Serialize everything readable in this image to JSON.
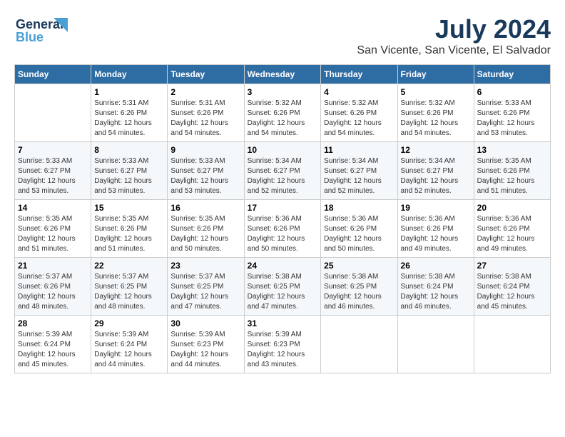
{
  "logo": {
    "line1": "General",
    "line2": "Blue"
  },
  "title": "July 2024",
  "subtitle": "San Vicente, San Vicente, El Salvador",
  "days_of_week": [
    "Sunday",
    "Monday",
    "Tuesday",
    "Wednesday",
    "Thursday",
    "Friday",
    "Saturday"
  ],
  "weeks": [
    [
      {
        "day": "",
        "info": ""
      },
      {
        "day": "1",
        "info": "Sunrise: 5:31 AM\nSunset: 6:26 PM\nDaylight: 12 hours\nand 54 minutes."
      },
      {
        "day": "2",
        "info": "Sunrise: 5:31 AM\nSunset: 6:26 PM\nDaylight: 12 hours\nand 54 minutes."
      },
      {
        "day": "3",
        "info": "Sunrise: 5:32 AM\nSunset: 6:26 PM\nDaylight: 12 hours\nand 54 minutes."
      },
      {
        "day": "4",
        "info": "Sunrise: 5:32 AM\nSunset: 6:26 PM\nDaylight: 12 hours\nand 54 minutes."
      },
      {
        "day": "5",
        "info": "Sunrise: 5:32 AM\nSunset: 6:26 PM\nDaylight: 12 hours\nand 54 minutes."
      },
      {
        "day": "6",
        "info": "Sunrise: 5:33 AM\nSunset: 6:26 PM\nDaylight: 12 hours\nand 53 minutes."
      }
    ],
    [
      {
        "day": "7",
        "info": "Sunrise: 5:33 AM\nSunset: 6:27 PM\nDaylight: 12 hours\nand 53 minutes."
      },
      {
        "day": "8",
        "info": "Sunrise: 5:33 AM\nSunset: 6:27 PM\nDaylight: 12 hours\nand 53 minutes."
      },
      {
        "day": "9",
        "info": "Sunrise: 5:33 AM\nSunset: 6:27 PM\nDaylight: 12 hours\nand 53 minutes."
      },
      {
        "day": "10",
        "info": "Sunrise: 5:34 AM\nSunset: 6:27 PM\nDaylight: 12 hours\nand 52 minutes."
      },
      {
        "day": "11",
        "info": "Sunrise: 5:34 AM\nSunset: 6:27 PM\nDaylight: 12 hours\nand 52 minutes."
      },
      {
        "day": "12",
        "info": "Sunrise: 5:34 AM\nSunset: 6:27 PM\nDaylight: 12 hours\nand 52 minutes."
      },
      {
        "day": "13",
        "info": "Sunrise: 5:35 AM\nSunset: 6:26 PM\nDaylight: 12 hours\nand 51 minutes."
      }
    ],
    [
      {
        "day": "14",
        "info": "Sunrise: 5:35 AM\nSunset: 6:26 PM\nDaylight: 12 hours\nand 51 minutes."
      },
      {
        "day": "15",
        "info": "Sunrise: 5:35 AM\nSunset: 6:26 PM\nDaylight: 12 hours\nand 51 minutes."
      },
      {
        "day": "16",
        "info": "Sunrise: 5:35 AM\nSunset: 6:26 PM\nDaylight: 12 hours\nand 50 minutes."
      },
      {
        "day": "17",
        "info": "Sunrise: 5:36 AM\nSunset: 6:26 PM\nDaylight: 12 hours\nand 50 minutes."
      },
      {
        "day": "18",
        "info": "Sunrise: 5:36 AM\nSunset: 6:26 PM\nDaylight: 12 hours\nand 50 minutes."
      },
      {
        "day": "19",
        "info": "Sunrise: 5:36 AM\nSunset: 6:26 PM\nDaylight: 12 hours\nand 49 minutes."
      },
      {
        "day": "20",
        "info": "Sunrise: 5:36 AM\nSunset: 6:26 PM\nDaylight: 12 hours\nand 49 minutes."
      }
    ],
    [
      {
        "day": "21",
        "info": "Sunrise: 5:37 AM\nSunset: 6:26 PM\nDaylight: 12 hours\nand 48 minutes."
      },
      {
        "day": "22",
        "info": "Sunrise: 5:37 AM\nSunset: 6:25 PM\nDaylight: 12 hours\nand 48 minutes."
      },
      {
        "day": "23",
        "info": "Sunrise: 5:37 AM\nSunset: 6:25 PM\nDaylight: 12 hours\nand 47 minutes."
      },
      {
        "day": "24",
        "info": "Sunrise: 5:38 AM\nSunset: 6:25 PM\nDaylight: 12 hours\nand 47 minutes."
      },
      {
        "day": "25",
        "info": "Sunrise: 5:38 AM\nSunset: 6:25 PM\nDaylight: 12 hours\nand 46 minutes."
      },
      {
        "day": "26",
        "info": "Sunrise: 5:38 AM\nSunset: 6:24 PM\nDaylight: 12 hours\nand 46 minutes."
      },
      {
        "day": "27",
        "info": "Sunrise: 5:38 AM\nSunset: 6:24 PM\nDaylight: 12 hours\nand 45 minutes."
      }
    ],
    [
      {
        "day": "28",
        "info": "Sunrise: 5:39 AM\nSunset: 6:24 PM\nDaylight: 12 hours\nand 45 minutes."
      },
      {
        "day": "29",
        "info": "Sunrise: 5:39 AM\nSunset: 6:24 PM\nDaylight: 12 hours\nand 44 minutes."
      },
      {
        "day": "30",
        "info": "Sunrise: 5:39 AM\nSunset: 6:23 PM\nDaylight: 12 hours\nand 44 minutes."
      },
      {
        "day": "31",
        "info": "Sunrise: 5:39 AM\nSunset: 6:23 PM\nDaylight: 12 hours\nand 43 minutes."
      },
      {
        "day": "",
        "info": ""
      },
      {
        "day": "",
        "info": ""
      },
      {
        "day": "",
        "info": ""
      }
    ]
  ]
}
